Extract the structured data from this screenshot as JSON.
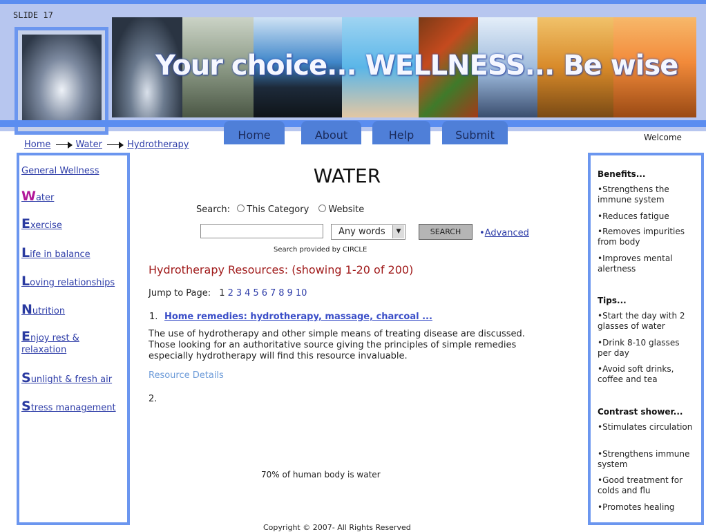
{
  "slide_label": "SLIDE 17",
  "banner": {
    "tagline": "Your choice... WELLNESS... Be wise",
    "background_color": "#b7c6ef",
    "accent_color": "#5b8df0"
  },
  "nav": {
    "tabs": [
      {
        "label": "Home"
      },
      {
        "label": "About"
      },
      {
        "label": "Help"
      },
      {
        "label": "Submit"
      }
    ]
  },
  "welcome": "Welcome",
  "breadcrumb": {
    "items": [
      "Home",
      "Water",
      "Hydrotherapy"
    ]
  },
  "left_nav": {
    "items": [
      {
        "cap": "",
        "rest": "General Wellness"
      },
      {
        "cap": "W",
        "rest": "ater"
      },
      {
        "cap": "E",
        "rest": "xercise"
      },
      {
        "cap": "L",
        "rest": "ife in balance"
      },
      {
        "cap": "L",
        "rest": "oving relationships"
      },
      {
        "cap": "N",
        "rest": "utrition"
      },
      {
        "cap": "E",
        "rest": "njoy rest &",
        "line2": "relaxation"
      },
      {
        "cap": "S",
        "rest": "unlight & fresh air"
      },
      {
        "cap": "S",
        "rest": "tress management"
      }
    ],
    "active_color": "#b2189a"
  },
  "main": {
    "title": "WATER",
    "search": {
      "label": "Search:",
      "option_category": "This Category",
      "option_website": "Website",
      "input_value": "",
      "match_value": "Any words",
      "button_label": "SEARCH",
      "advanced_label": "Advanced",
      "provided_by": "Search provided by CIRCLE"
    },
    "results_heading": "Hydrotherapy Resources: (showing 1-20 of 200)",
    "jump_label": "Jump to Page:",
    "pages": [
      "1",
      "2",
      "3",
      "4",
      "5",
      "6",
      "7",
      "8",
      "9",
      "10"
    ],
    "result1": {
      "number": "1.",
      "title": "Home remedies:  hydrotherapy, massage, charcoal ...",
      "description": "The use of hydrotherapy and other simple means of treating disease are discussed.  Those looking for an authoritative source giving the principles of simple remedies especially hydrotherapy will find this resource invaluable.",
      "details_link": "Resource Details"
    },
    "result2": {
      "number": "2."
    },
    "fact": "70% of human body is water",
    "copyright": "Copyright  © 2007- All Rights Reserved"
  },
  "right_sidebar": {
    "benefits_heading": "Benefits...",
    "benefits": [
      "Strengthens the immune system",
      "Reduces fatigue",
      "Removes impurities from body",
      "Improves mental alertness"
    ],
    "tips_heading": "Tips...",
    "tips": [
      "Start the day with 2 glasses of water",
      "Drink 8-10 glasses per day",
      "Avoid soft drinks, coffee and tea"
    ],
    "contrast_heading": "Contrast shower...",
    "contrast": [
      "Stimulates circulation",
      "Strengthens immune system",
      "Good treatment for colds and flu",
      "Promotes healing"
    ]
  }
}
